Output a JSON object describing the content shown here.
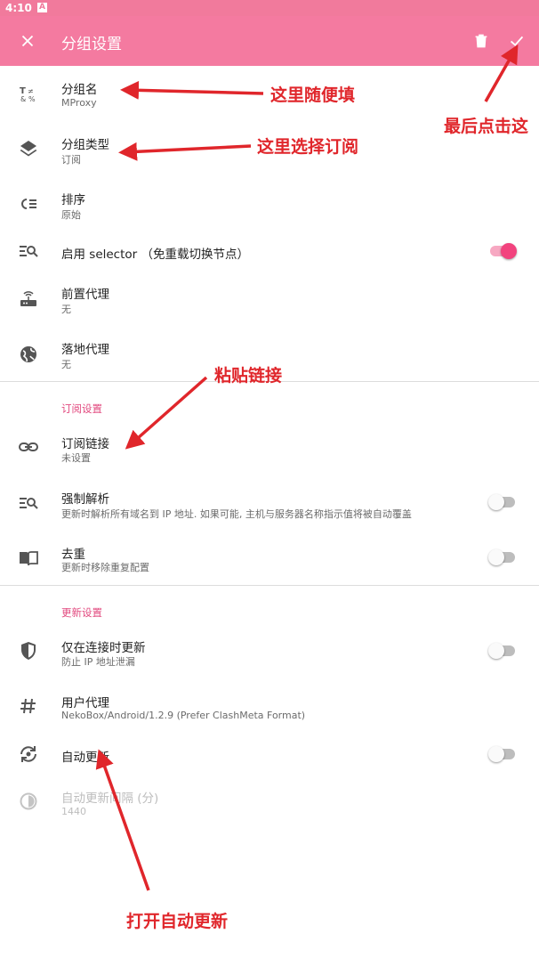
{
  "status_bar": {
    "time": "4:10",
    "icon": "A"
  },
  "app_bar": {
    "title": "分组设置"
  },
  "rows": {
    "group_name": {
      "title": "分组名",
      "subtitle": "MProxy"
    },
    "group_type": {
      "title": "分组类型",
      "subtitle": "订阅"
    },
    "sort": {
      "title": "排序",
      "subtitle": "原始"
    },
    "selector": {
      "title": "启用 selector （免重载切换节点）",
      "checked": true
    },
    "front_proxy": {
      "title": "前置代理",
      "subtitle": "无"
    },
    "landing_proxy": {
      "title": "落地代理",
      "subtitle": "无"
    },
    "sub_link": {
      "title": "订阅链接",
      "subtitle": "未设置"
    },
    "force_resolve": {
      "title": "强制解析",
      "subtitle": "更新时解析所有域名到 IP 地址. 如果可能, 主机与服务器名称指示值将被自动覆盖",
      "checked": false
    },
    "dedup": {
      "title": "去重",
      "subtitle": "更新时移除重复配置",
      "checked": false
    },
    "update_when_connected": {
      "title": "仅在连接时更新",
      "subtitle": "防止 IP 地址泄漏",
      "checked": false
    },
    "user_agent": {
      "title": "用户代理",
      "subtitle": "NekoBox/Android/1.2.9 (Prefer ClashMeta Format)"
    },
    "auto_update": {
      "title": "自动更新",
      "checked": false
    },
    "auto_update_interval": {
      "title": "自动更新间隔 (分)",
      "subtitle": "1440"
    }
  },
  "sections": {
    "subscription": "订阅设置",
    "update": "更新设置"
  },
  "annotations": {
    "name": "这里随便填",
    "type": "这里选择订阅",
    "confirm": "最后点击这",
    "link": "粘贴链接",
    "auto_update": "打开自动更新"
  },
  "colors": {
    "primary": "#f47aa0",
    "accent": "#f2437e",
    "annotation": "#e0262b"
  }
}
